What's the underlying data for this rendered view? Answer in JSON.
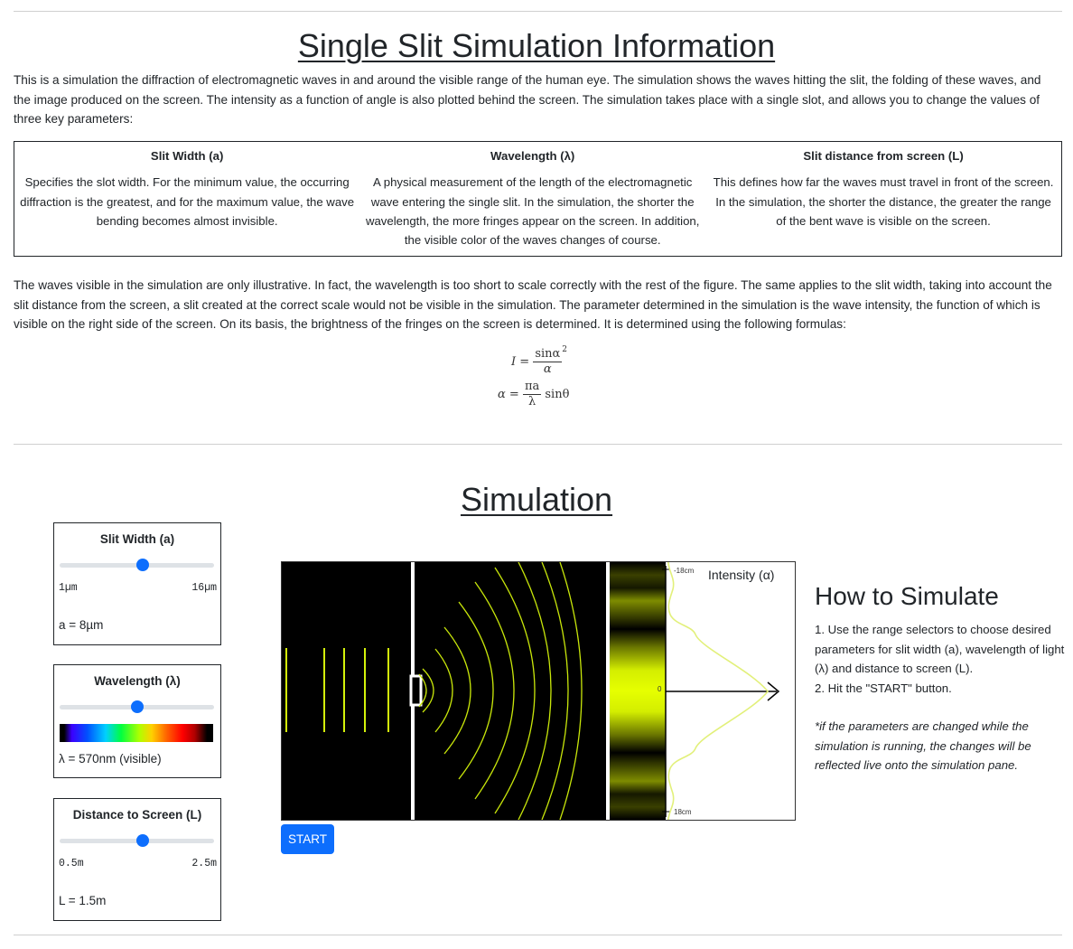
{
  "info": {
    "title": "Single Slit Simulation Information",
    "intro": "This is a simulation the diffraction of electromagnetic waves in and around the visible range of the human eye. The simulation shows the waves hitting the slit, the folding of these waves, and the image produced on the screen. The intensity as a function of angle is also plotted behind the screen. The simulation takes place with a single slot, and allows you to change the values of three key parameters:",
    "table": {
      "headers": [
        "Slit Width (a)",
        "Wavelength (λ)",
        "Slit distance from screen (L)"
      ],
      "cells": [
        "Specifies the slot width. For the minimum value, the occurring diffraction is the greatest, and for the maximum value, the wave bending becomes almost invisible.",
        "A physical measurement of the length of the electromagnetic wave entering the single slit. In the simulation, the shorter the wavelength, the more fringes appear on the screen. In addition, the visible color of the waves changes of course.",
        "This defines how far the waves must travel in front of the screen. In the simulation, the shorter the distance, the greater the range of the bent wave is visible on the screen."
      ]
    },
    "note": "The waves visible in the simulation are only illustrative. In fact, the wavelength is too short to scale correctly with the rest of the figure. The same applies to the slit width, taking into account the slit distance from the screen, a slit created at the correct scale would not be visible in the simulation. The parameter determined in the simulation is the wave intensity, the function of which is visible on the right side of the screen. On its basis, the brightness of the fringes on the screen is determined. It is determined using the following formulas:",
    "formula1": {
      "lhs": "I =",
      "num": "sinα",
      "den": "α",
      "exp": "2"
    },
    "formula2": {
      "lhs": "α =",
      "num": "πa",
      "den": "λ",
      "rhs": "sinθ"
    }
  },
  "simulation": {
    "title": "Simulation",
    "slit_width": {
      "label": "Slit Width (a)",
      "min": "1µm",
      "max": "16µm",
      "value_text": "a = 8µm",
      "fraction": 0.5
    },
    "wavelength": {
      "label": "Wavelength (λ)",
      "value_text": "λ = 570nm (visible)",
      "fraction": 0.5
    },
    "distance": {
      "label": "Distance to Screen (L)",
      "min": "0.5m",
      "max": "2.5m",
      "value_text": "L = 1.5m",
      "fraction": 0.5
    },
    "canvas": {
      "top_label": "-18cm",
      "bottom_label": "18cm",
      "zero_label": "0",
      "plot_title": "Intensity (α)",
      "wave_color": "#d4f20a",
      "fringe_color": "#e6ff00"
    },
    "start_label": "START"
  },
  "howto": {
    "title": "How to Simulate",
    "step1": "1. Use the range selectors to choose desired parameters for slit width (a), wavelength of light (λ) and distance to screen (L).",
    "step2": "2. Hit the \"START\" button.",
    "note": "*if the parameters are changed while the simulation is running, the changes will be reflected live onto the simulation pane."
  }
}
